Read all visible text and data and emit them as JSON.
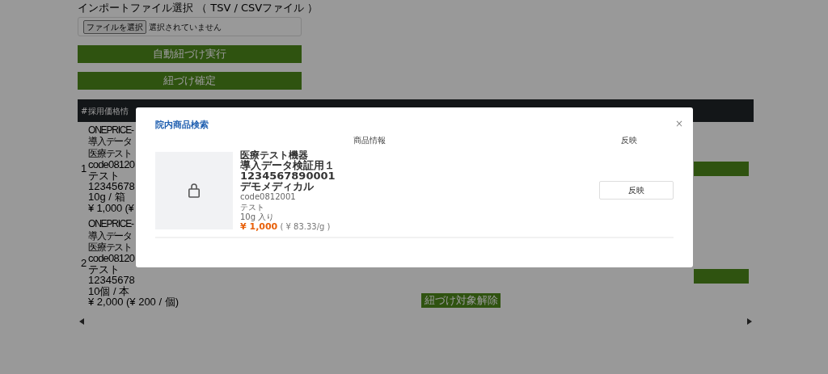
{
  "import": {
    "label": "インポートファイル選択 （ TSV / CSVファイル ）",
    "file_button": "ファイルを選択",
    "file_status": "選択されていません"
  },
  "buttons": [
    "自動紐づけ実行",
    "紐づけ確定"
  ],
  "table": {
    "columns": [
      "#",
      "採用価格情"
    ],
    "rows": [
      {
        "number": "1",
        "lines": [
          "ONEPRICE-",
          "導入データ",
          "医療テスト",
          "code08120",
          "テスト",
          "12345678",
          "10g / 箱",
          "¥ 1,000 (¥"
        ],
        "actions": [
          {
            "kind": "bar"
          }
        ]
      },
      {
        "number": "2",
        "lines": [
          "ONEPRICE-",
          "導入データ",
          "医療テスト",
          "code08120",
          "テスト",
          "12345678",
          "10個 / 本",
          "¥ 2,000 (¥ 200 / 個)"
        ],
        "actions": [
          {
            "kind": "bar"
          },
          {
            "kind": "button",
            "label": "紐づけ対象解除"
          }
        ]
      }
    ]
  },
  "modal": {
    "title": "院内商品検索",
    "close": "×",
    "columns": [
      "商品情報",
      "反映"
    ],
    "results": [
      {
        "name": "医療テスト機器",
        "subtitle": "導入データ検証用１",
        "jan": "1234567890001",
        "maker": "デモメディカル",
        "code": "code0812001",
        "category": "テスト",
        "package": "10g 入り",
        "price": "¥ 1,000",
        "unit_price": "( ¥ 83.33/g )",
        "button": "反映"
      }
    ]
  }
}
